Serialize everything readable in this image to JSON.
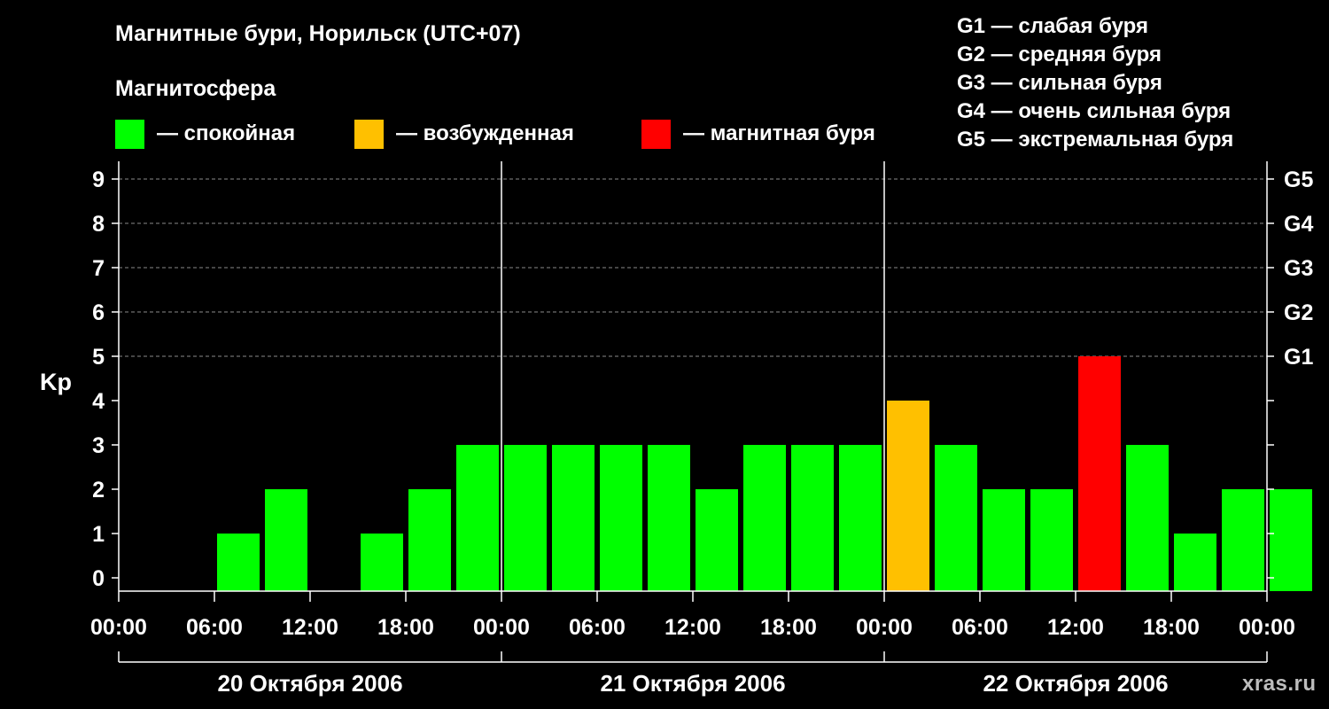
{
  "title": "Магнитные бури, Норильск (UTC+07)",
  "subtitle": "Магнитосфера",
  "legend": [
    {
      "label": "— спокойная",
      "color": "#00ff00"
    },
    {
      "label": "— возбужденная",
      "color": "#ffc000"
    },
    {
      "label": "— магнитная буря",
      "color": "#ff0000"
    }
  ],
  "storm_levels": [
    "G1 — слабая буря",
    "G2 — средняя буря",
    "G3 — сильная буря",
    "G4 — очень сильная буря",
    "G5 — экстремальная буря"
  ],
  "watermark": "xras.ru",
  "chart_data": {
    "type": "bar",
    "ylabel": "Kp",
    "ylim": [
      0,
      9
    ],
    "y_ticks": [
      "0",
      "1",
      "2",
      "3",
      "4",
      "5",
      "6",
      "7",
      "8",
      "9"
    ],
    "right_ticks": [
      {
        "value": 5,
        "label": "G1"
      },
      {
        "value": 6,
        "label": "G2"
      },
      {
        "value": 7,
        "label": "G3"
      },
      {
        "value": 8,
        "label": "G4"
      },
      {
        "value": 9,
        "label": "G5"
      }
    ],
    "x_tick_labels": [
      "00:00",
      "06:00",
      "12:00",
      "18:00",
      "00:00",
      "06:00",
      "12:00",
      "18:00",
      "00:00",
      "06:00",
      "12:00",
      "18:00",
      "00:00"
    ],
    "dates": [
      "20 Октября 2006",
      "21 Октября 2006",
      "22 Октября 2006"
    ],
    "interval_hours": 3,
    "values": [
      0,
      0,
      1,
      2,
      0,
      1,
      2,
      3,
      3,
      3,
      3,
      3,
      2,
      3,
      3,
      3,
      4,
      3,
      2,
      2,
      5,
      3,
      1,
      2,
      2
    ],
    "levels": [
      "quiet",
      "quiet",
      "quiet",
      "quiet",
      "quiet",
      "quiet",
      "quiet",
      "quiet",
      "quiet",
      "quiet",
      "quiet",
      "quiet",
      "quiet",
      "quiet",
      "quiet",
      "quiet",
      "disturbed",
      "quiet",
      "quiet",
      "quiet",
      "storm",
      "quiet",
      "quiet",
      "quiet",
      "quiet"
    ],
    "colors": {
      "quiet": "#00ff00",
      "disturbed": "#ffc000",
      "storm": "#ff0000"
    },
    "grid": true
  }
}
